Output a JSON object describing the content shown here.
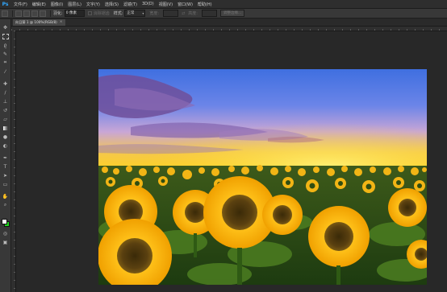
{
  "app": {
    "logo": "Ps"
  },
  "menu": [
    "文件(F)",
    "编辑(E)",
    "图像(I)",
    "图层(L)",
    "文字(Y)",
    "选择(S)",
    "滤镜(T)",
    "3D(D)",
    "视图(V)",
    "窗口(W)",
    "帮助(H)"
  ],
  "options": {
    "feather_label": "羽化:",
    "feather_value": "0 像素",
    "antialias_label": "消除锯齿",
    "style_label": "样式:",
    "style_value": "正常",
    "width_label": "宽度:",
    "height_label": "高度:",
    "refine_edge_label": "调整边缘..."
  },
  "document": {
    "tab_title": "向日葵 1 @ 100%(RGB/8)",
    "tab_close": "×"
  },
  "colors": {
    "foreground": "#ffffff",
    "background": "#1fd31f",
    "accent": "#31a8ff"
  },
  "tools": [
    "move-icon",
    "marquee-icon",
    "lasso-icon",
    "quick-select-icon",
    "crop-icon",
    "eyedropper-icon",
    "healing-icon",
    "brush-icon",
    "clone-stamp-icon",
    "history-brush-icon",
    "eraser-icon",
    "gradient-icon",
    "blur-icon",
    "dodge-icon",
    "pen-icon",
    "type-icon",
    "path-select-icon",
    "shape-icon",
    "hand-icon",
    "zoom-icon"
  ]
}
